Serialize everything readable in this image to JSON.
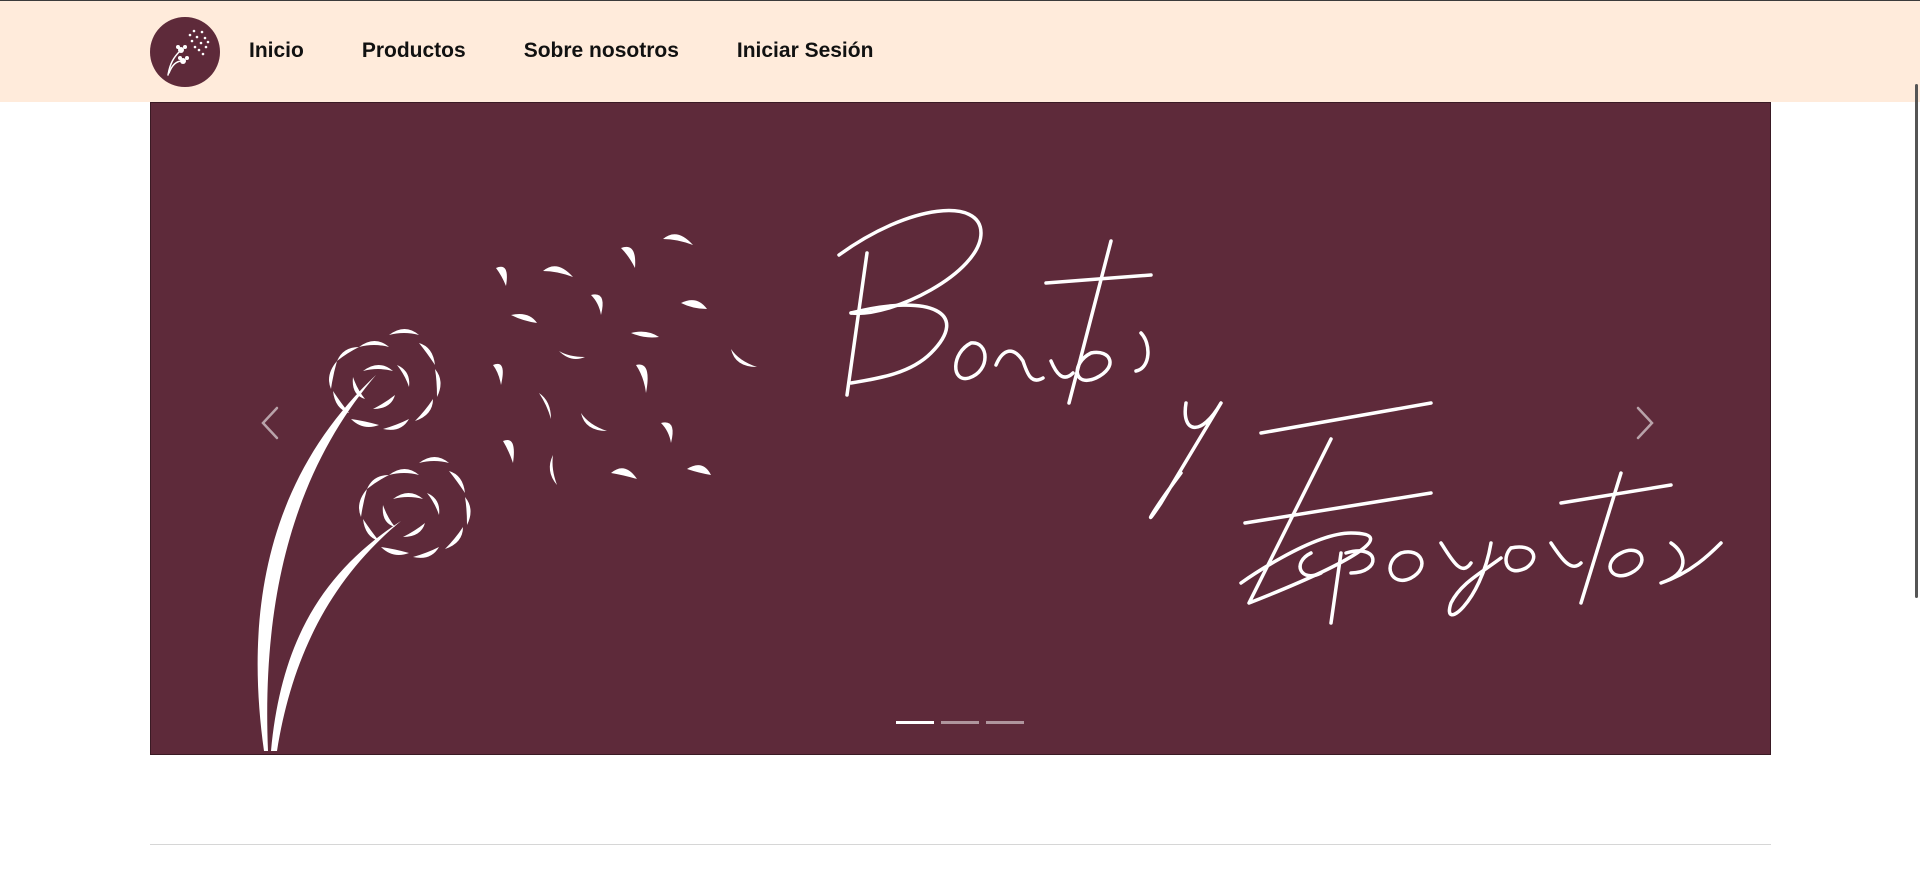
{
  "nav": {
    "items": [
      {
        "label": "Inicio"
      },
      {
        "label": "Productos"
      },
      {
        "label": "Sobre nosotros"
      },
      {
        "label": "Iniciar Sesión"
      }
    ],
    "background": "#ffebdb",
    "logo_icon": "dandelion-logo-icon"
  },
  "hero": {
    "background": "#5e2a3a",
    "banner_text": "Bonitos y Esponjositos",
    "prev_icon": "chevron-left-icon",
    "next_icon": "chevron-right-icon",
    "indicators": [
      {
        "active": true
      },
      {
        "active": false
      },
      {
        "active": false
      }
    ]
  }
}
